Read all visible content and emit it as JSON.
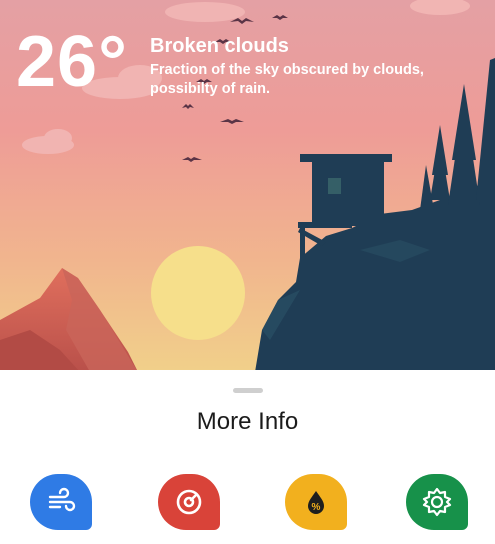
{
  "weather": {
    "temperature": "26°",
    "condition": "Broken clouds",
    "description": "Fraction of the sky obscured by clouds, possibilty of rain."
  },
  "sheet": {
    "title": "More Info"
  },
  "info_buttons": [
    {
      "icon": "wind-icon",
      "color": "#2f7be5"
    },
    {
      "icon": "pressure-icon",
      "color": "#d94339"
    },
    {
      "icon": "humidity-icon",
      "color": "#f2b01e"
    },
    {
      "icon": "uv-sun-icon",
      "color": "#17914a"
    }
  ],
  "colors": {
    "sky_top": "#e49a9b",
    "sky_bottom": "#f1c987",
    "sun": "#f5dd86",
    "silhouette": "#1f3d55",
    "mountain": "#c55a4f"
  }
}
